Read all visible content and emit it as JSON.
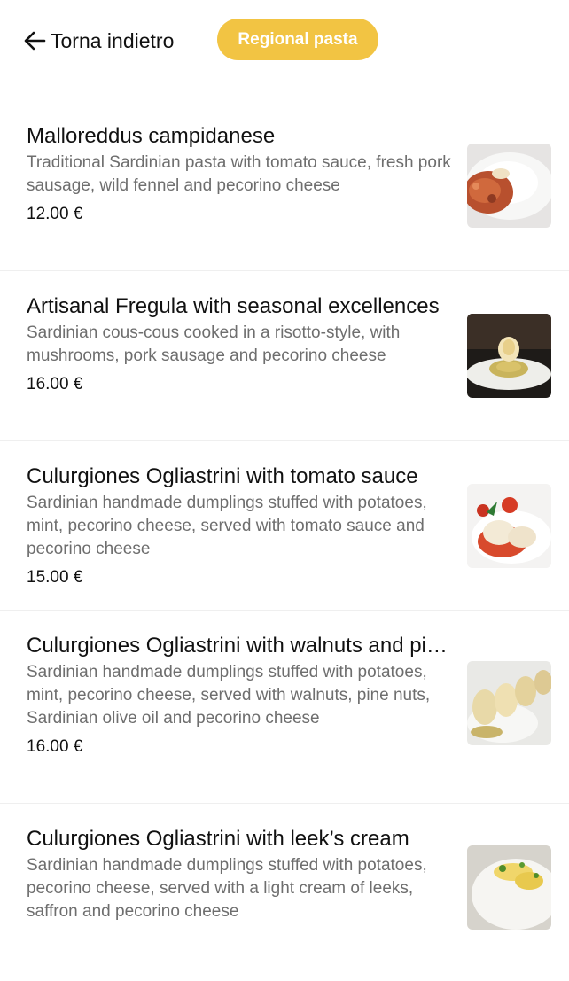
{
  "header": {
    "back_label": "Torna indietro",
    "category_label": "Regional pasta"
  },
  "items": [
    {
      "name": "Malloreddus campidanese",
      "description": "Traditional Sardinian pasta with tomato sauce, fresh pork sausage, wild fennel and pecorino cheese",
      "price": "12.00 €"
    },
    {
      "name": "Artisanal Fregula with seasonal excellences",
      "description": "Sardinian cous-cous cooked in a risotto-style, with mushrooms, pork sausage and pecorino cheese",
      "price": "16.00 €"
    },
    {
      "name": "Culurgiones Ogliastrini with tomato sauce",
      "description": "Sardinian handmade dumplings stuffed with potatoes, mint, pecorino cheese, served with tomato sauce and pecorino cheese",
      "price": "15.00 €"
    },
    {
      "name": "Culurgiones Ogliastrini with walnuts and pine nuts",
      "description": "Sardinian handmade dumplings stuffed with potatoes, mint, pecorino cheese, served with walnuts, pine nuts, Sardinian olive oil and pecorino cheese",
      "price": "16.00 €"
    },
    {
      "name": "Culurgiones Ogliastrini with leek’s cream",
      "description": " Sardinian handmade dumplings stuffed with potatoes, pecorino cheese, served with a light cream of leeks, saffron and pecorino cheese",
      "price": ""
    }
  ],
  "colors": {
    "accent": "#f2c443",
    "price_text": "#111111",
    "description_text": "#6e6e6e"
  }
}
